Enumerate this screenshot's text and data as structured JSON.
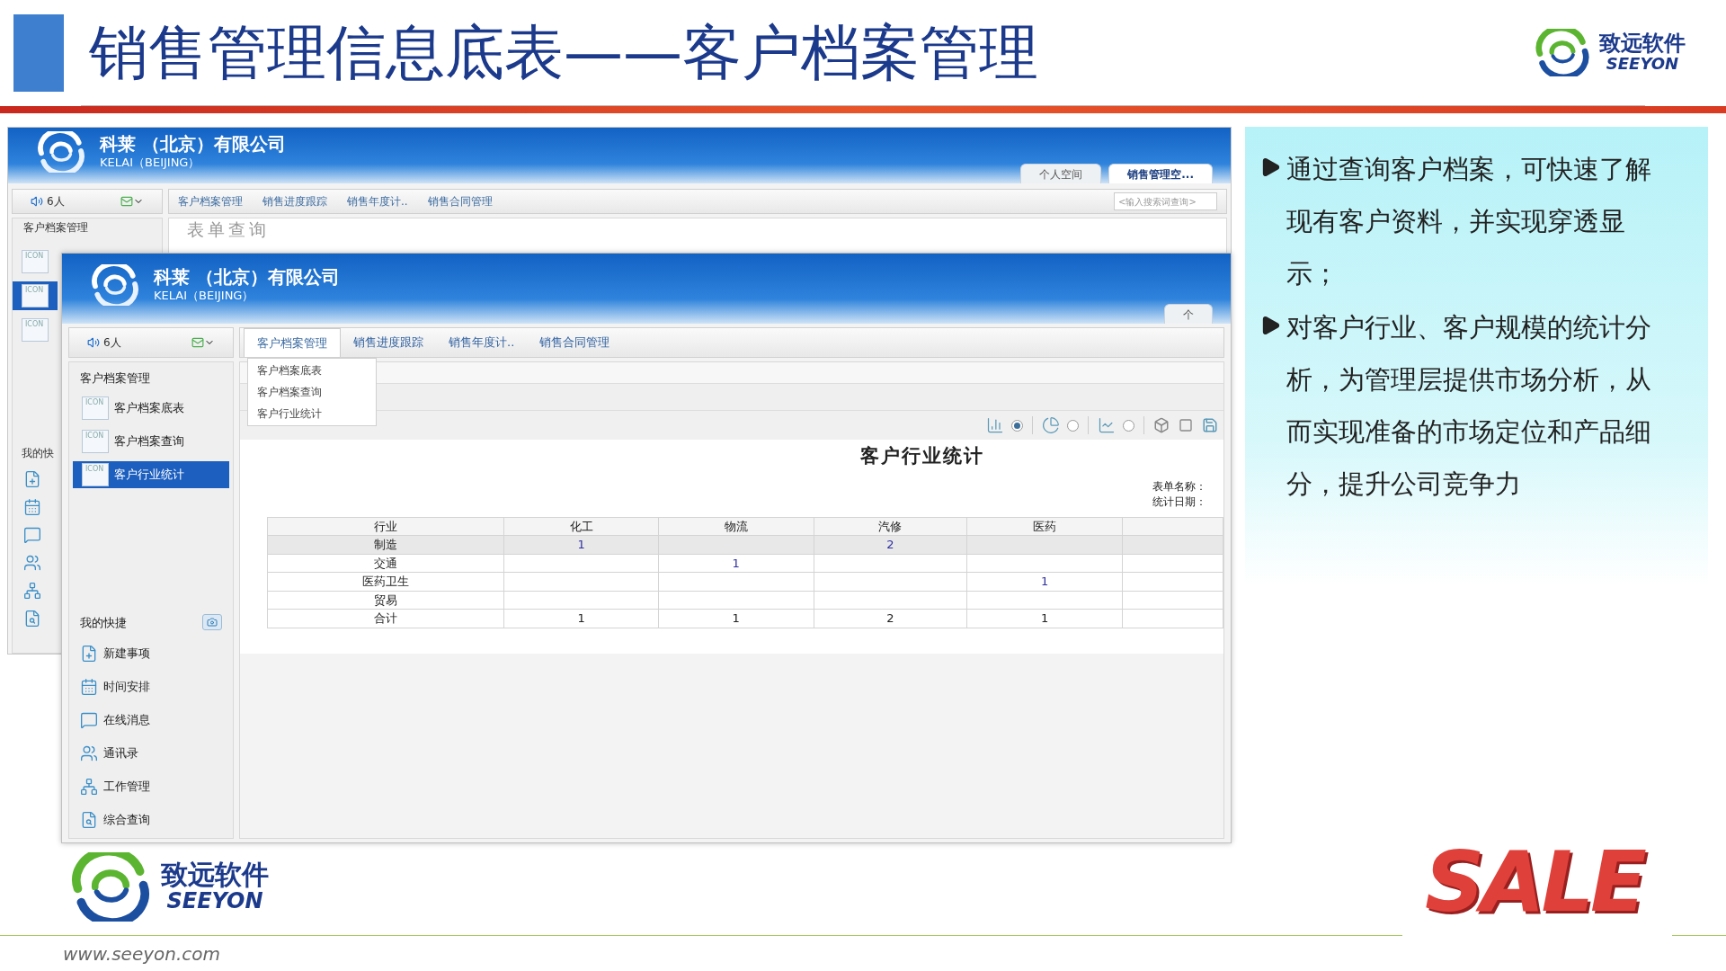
{
  "slide": {
    "title": "销售管理信息底表——客户档案管理",
    "logo": {
      "name": "致远软件",
      "brand": "SEEYON"
    }
  },
  "back_window": {
    "company": "科莱 （北京）有限公司",
    "company_en": "KELAI（BEIJING）",
    "space_tabs": [
      {
        "label": "个人空间",
        "selected": false
      },
      {
        "label": "销售管理空...",
        "selected": true
      }
    ],
    "online_count": "6人",
    "menu_tabs": [
      {
        "label": "客户档案管理"
      },
      {
        "label": "销售进度跟踪"
      },
      {
        "label": "销售年度计.."
      },
      {
        "label": "销售合同管理"
      }
    ],
    "search": {
      "placeholder": "<输入搜索词查询>"
    },
    "sidebar_title": "客户档案管理",
    "sidebar_items": [
      {
        "icon_label": "ICON",
        "selected": false
      },
      {
        "icon_label": "ICON",
        "selected": true
      },
      {
        "icon_label": "ICON",
        "selected": false
      }
    ],
    "page_heading": "表单查询",
    "shortcut_heading": "我的快",
    "shortcuts": [
      {
        "kind": "new"
      },
      {
        "kind": "calendar"
      },
      {
        "kind": "message"
      },
      {
        "kind": "contacts"
      },
      {
        "kind": "work"
      },
      {
        "kind": "search"
      }
    ]
  },
  "front_window": {
    "company": "科莱 （北京）有限公司",
    "company_en": "KELAI（BEIJING）",
    "space_tabs": [
      {
        "label": "个",
        "selected": false
      }
    ],
    "online_count": "6人",
    "menu_tabs": [
      {
        "label": "客户档案管理",
        "selected": true
      },
      {
        "label": "销售进度跟踪",
        "selected": false
      },
      {
        "label": "销售年度计..",
        "selected": false
      },
      {
        "label": "销售合同管理",
        "selected": false
      }
    ],
    "dropdown": [
      "客户档案底表",
      "客户档案查询",
      "客户行业统计"
    ],
    "sidebar_title": "客户档案管理",
    "sidebar_items": [
      {
        "label": "客户档案底表",
        "icon_label": "ICON",
        "selected": false
      },
      {
        "label": "客户档案查询",
        "icon_label": "ICON",
        "selected": false
      },
      {
        "label": "客户行业统计",
        "icon_label": "ICON",
        "selected": true
      }
    ],
    "shortcut_heading": "我的快捷",
    "shortcuts": [
      {
        "label": "新建事项",
        "kind": "new"
      },
      {
        "label": "时间安排",
        "kind": "calendar"
      },
      {
        "label": "在线消息",
        "kind": "message"
      },
      {
        "label": "通讯录",
        "kind": "contacts"
      },
      {
        "label": "工作管理",
        "kind": "work"
      },
      {
        "label": "综合查询",
        "kind": "search"
      }
    ],
    "chart_types": [
      {
        "kind": "bar",
        "selected": true
      },
      {
        "kind": "pie",
        "selected": false
      },
      {
        "kind": "line",
        "selected": false
      }
    ],
    "report": {
      "title": "客户行业统计",
      "meta": [
        "表单名称：",
        "统计日期："
      ],
      "columns": [
        "行业",
        "化工",
        "物流",
        "汽修",
        "医药"
      ],
      "rows": [
        {
          "kind": "data",
          "selected": true,
          "cells": [
            "制造",
            "1",
            null,
            "2",
            null
          ]
        },
        {
          "kind": "data",
          "selected": false,
          "cells": [
            "交通",
            null,
            "1",
            null,
            null
          ]
        },
        {
          "kind": "data",
          "selected": false,
          "cells": [
            "医药卫生",
            null,
            null,
            null,
            "1"
          ]
        },
        {
          "kind": "data",
          "selected": false,
          "cells": [
            "贸易",
            null,
            null,
            null,
            null
          ]
        },
        {
          "kind": "total",
          "selected": false,
          "cells": [
            "合计",
            "1",
            "1",
            "2",
            "1"
          ]
        }
      ]
    }
  },
  "notes": {
    "bullets": [
      "通过查询客户档案，可快速了解现有客户资料，并实现穿透显示；",
      "对客户行业、客户规模的统计分析，为管理层提供市场分析，从而实现准备的市场定位和产品细分，提升公司竞争力"
    ]
  },
  "footer": {
    "logo": {
      "name": "致远软件",
      "brand": "SEEYON"
    },
    "url": "www.seeyon.com",
    "badge": "SALE"
  }
}
